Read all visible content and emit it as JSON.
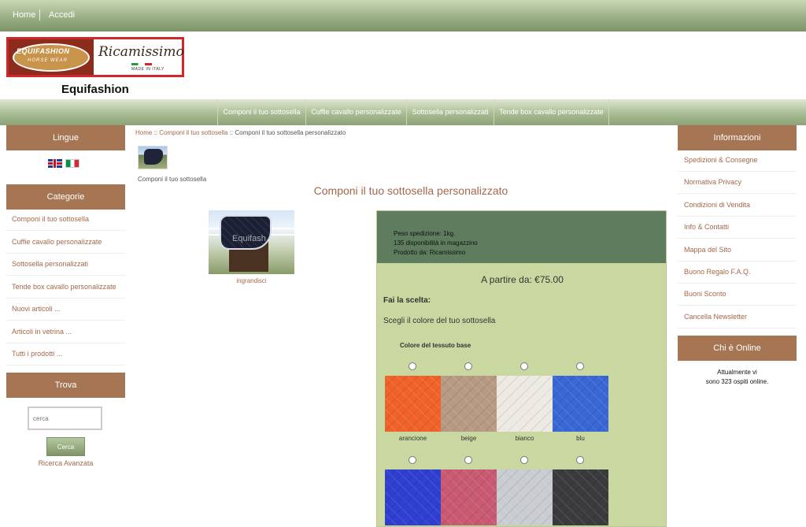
{
  "topnav": {
    "home": "Home",
    "login": "Accedi"
  },
  "logo": {
    "brand1": "EQUIFASHION",
    "brand1_sub": "HORSE WEAR",
    "brand2": "Ricamissimo",
    "brand2_sub": "MADE IN ITALY"
  },
  "site_title": "Equifashion",
  "mainnav": [
    "Componi il tuo sottosella",
    "Cuffie cavallo personalizzate",
    "Sottosella personalizzati",
    "Tende box cavallo personalizzate"
  ],
  "left": {
    "languages_title": "Lingue",
    "categories_title": "Categorie",
    "categories": [
      "Componi il tuo sottosella",
      "Cuffie cavallo personalizzate",
      "Sottosella personalizzati",
      "Tende box cavallo personalizzate",
      "Nuovi articoli ...",
      "Articoli in vetrina ...",
      "Tutti i prodotti ..."
    ],
    "search_title": "Trova",
    "search_placeholder": "cerca",
    "search_button": "Cerca",
    "advanced_search": "Ricerca Avanzata"
  },
  "right": {
    "info_title": "Informazioni",
    "info": [
      "Spedizioni & Consegne",
      "Normativa Privacy",
      "Condizioni di Vendita",
      "Info & Contatti",
      "Mappa del Sito",
      "Buono Regalo F.A.Q.",
      "Buoni Sconto",
      "Cancella Newsletter"
    ],
    "online_title": "Chi è Online",
    "online_line1": "Attualmente vi",
    "online_line2": "sono 323 ospiti online."
  },
  "breadcrumb": {
    "home": "Home",
    "sep": "::",
    "cat": "Componi il tuo sottosella",
    "current": "Componi il tuo sottosella personalizzato"
  },
  "category_caption": "Componi il tuo sottosella",
  "product": {
    "title": "Componi il tuo sottosella personalizzato",
    "watermark": "Equifash",
    "enlarge": "ingrandisci",
    "weight": "Peso spedizione: 1kg.",
    "stock": "135 disponibilità in magazzino",
    "maker": "Prodotto da: Ricamissimo",
    "price": "A partire da: €75.00",
    "choose": "Fai la scelta:",
    "choose_sub": "Scegli il colore del tuo sottosella",
    "fabric_label": "Colore del tessuto base",
    "colors": [
      {
        "name": "arancione",
        "hex": "#f0622a"
      },
      {
        "name": "beige",
        "hex": "#b89a82"
      },
      {
        "name": "bianco",
        "hex": "#eceae2"
      },
      {
        "name": "blu",
        "hex": "#3a67d6"
      },
      {
        "name": "",
        "hex": "#2f3fd0"
      },
      {
        "name": "",
        "hex": "#c85a72"
      },
      {
        "name": "",
        "hex": "#c9ccd0"
      },
      {
        "name": "",
        "hex": "#3b3b3e"
      }
    ]
  }
}
